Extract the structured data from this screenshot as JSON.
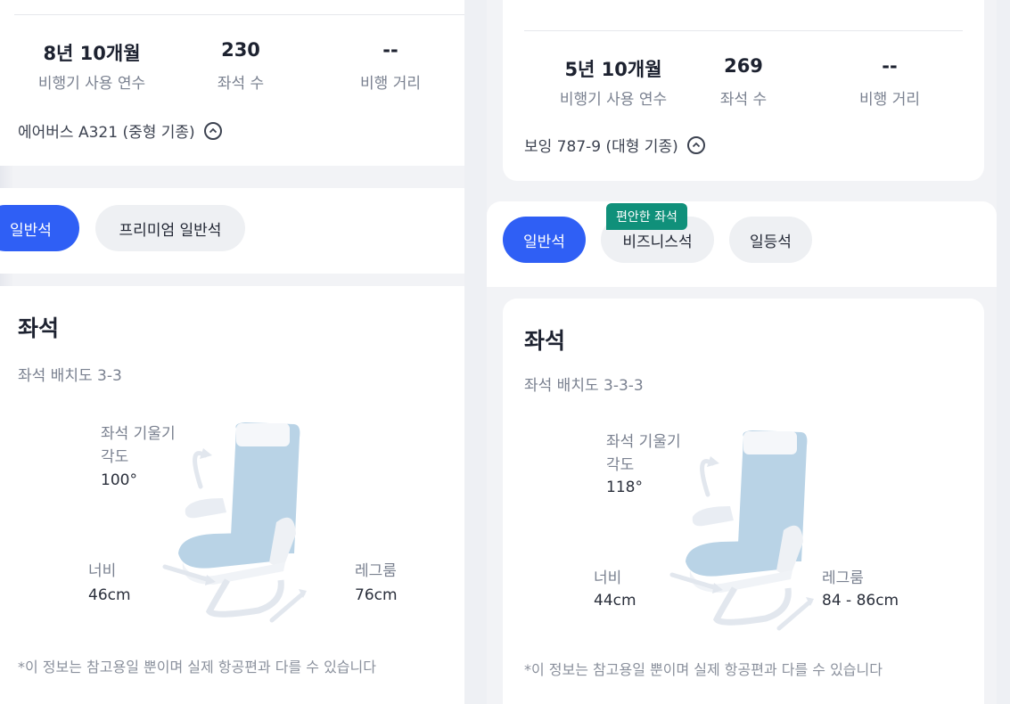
{
  "left": {
    "partial_header": "",
    "stats": [
      {
        "value": "8년 10개월",
        "label": "비행기 사용 연수"
      },
      {
        "value": "230",
        "label": "좌석 수"
      },
      {
        "value": "--",
        "label": "비행 거리"
      }
    ],
    "aircraft": "에어버스 A321 (중형 기종)",
    "tabs": [
      "일반석",
      "프리미엄 일반석"
    ],
    "seat_section": {
      "title": "좌석",
      "layout": "좌석 배치도 3-3",
      "recline_label_1": "좌석 기울기",
      "recline_label_2": "각도",
      "recline_value": "100°",
      "width_label": "너비",
      "width_value": "46cm",
      "legroom_label": "레그룸",
      "legroom_value": "76cm",
      "note": "*이 정보는 참고용일 뿐이며 실제 항공편과 다를 수 있습니다"
    }
  },
  "right": {
    "partial_header": "",
    "stats": [
      {
        "value": "5년 10개월",
        "label": "비행기 사용 연수"
      },
      {
        "value": "269",
        "label": "좌석 수"
      },
      {
        "value": "--",
        "label": "비행 거리"
      }
    ],
    "aircraft": "보잉 787-9 (대형 기종)",
    "badge": "편안한 좌석",
    "tabs": [
      "일반석",
      "비즈니스석",
      "일등석"
    ],
    "seat_section": {
      "title": "좌석",
      "layout": "좌석 배치도 3-3-3",
      "recline_label_1": "좌석 기울기",
      "recline_label_2": "각도",
      "recline_value": "118°",
      "width_label": "너비",
      "width_value": "44cm",
      "legroom_label": "레그룸",
      "legroom_value": "84 - 86cm",
      "note": "*이 정보는 참고용일 뿐이며 실제 항공편과 다를 수 있습니다"
    }
  },
  "colors": {
    "accent": "#2f5ff5",
    "badge": "#10907a",
    "seat": "#b9d3e6"
  },
  "icons": [
    "chevron-up-icon",
    "seat-illustration-icon"
  ]
}
